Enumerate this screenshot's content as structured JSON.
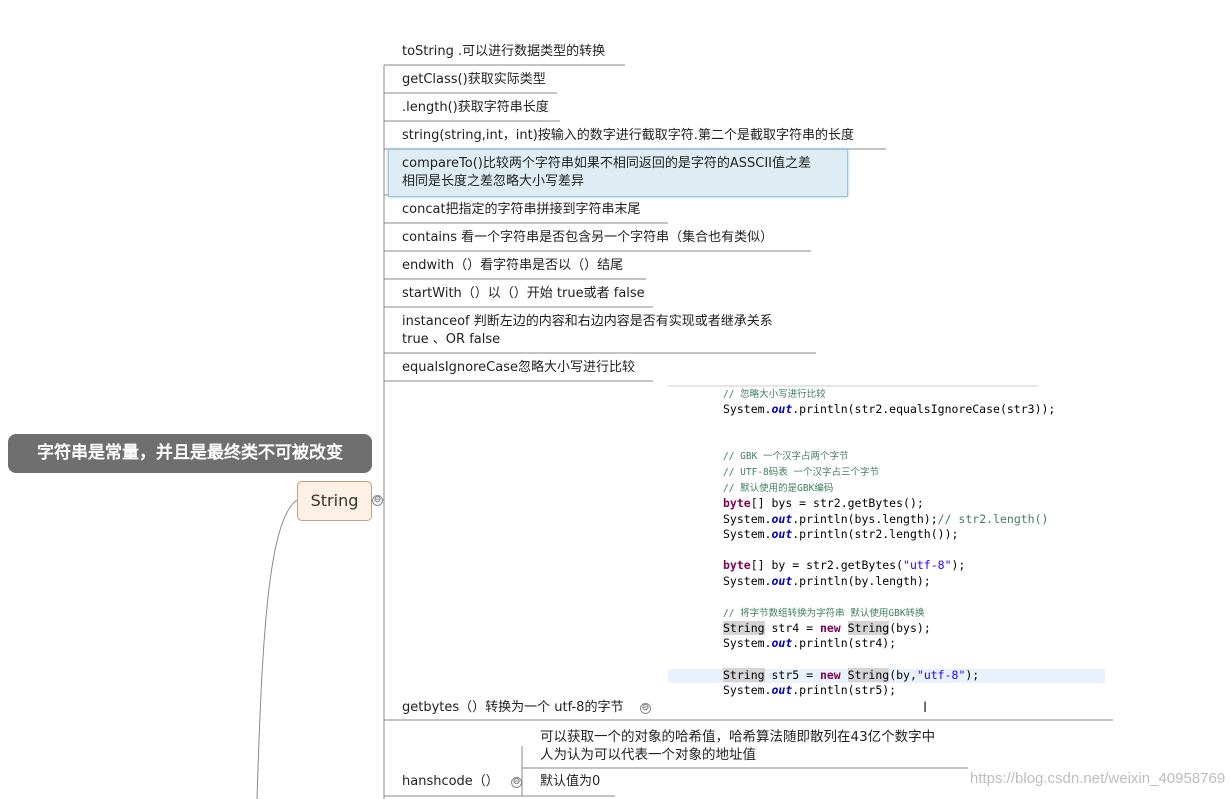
{
  "root": {
    "label": "字符串是常量，并且是最终类不可被改变"
  },
  "center": {
    "label": "String",
    "collapse_symbol": "⊖"
  },
  "topics": [
    {
      "id": "tostring",
      "lines": [
        "toString .可以进行数据类型的转换"
      ]
    },
    {
      "id": "getclass",
      "lines": [
        "getClass()获取实际类型"
      ]
    },
    {
      "id": "length",
      "lines": [
        ".length()获取字符串长度"
      ]
    },
    {
      "id": "substring",
      "lines": [
        "string(string,int，int)按输入的数字进行截取字符.第二个是截取字符串的长度"
      ]
    },
    {
      "id": "compareto",
      "lines": [
        "compareTo()比较两个字符串如果不相同返回的是字符的ASSCII值之差",
        "相同是长度之差忽略大小写差异"
      ]
    },
    {
      "id": "concat",
      "lines": [
        "concat把指定的字符串拼接到字符串末尾"
      ]
    },
    {
      "id": "contains",
      "lines": [
        "contains 看一个字符串是否包含另一个字符串（集合也有类似）"
      ]
    },
    {
      "id": "endwith",
      "lines": [
        "endwith（）看字符串是否以（）结尾"
      ]
    },
    {
      "id": "startwith",
      "lines": [
        "startWith（）以（）开始 true或者 false"
      ]
    },
    {
      "id": "instanceof",
      "lines": [
        "instanceof   判断左边的内容和右边内容是否有实现或者继承关系",
        "true       、OR   false"
      ]
    },
    {
      "id": "equalsignorecase",
      "lines": [
        "equalsIgnoreCase忽略大小写进行比较"
      ]
    },
    {
      "id": "getbytes",
      "lines": [
        "getbytes（）转换为一个 utf-8的字节"
      ]
    },
    {
      "id": "hashcode",
      "lines": [
        "hanshcode（）"
      ]
    }
  ],
  "hashcode_children": [
    {
      "id": "hash-desc",
      "lines": [
        "可以获取一个的对象的哈希值，哈希算法随即散列在43亿个数字中",
        "人为认为可以代表一个对象的地址值"
      ]
    },
    {
      "id": "hash-default",
      "lines": [
        "默认值为0"
      ]
    }
  ],
  "code_lines": [
    "// 忽略大小写进行比较",
    "System.out.println(str2.equalsIgnoreCase(str3));",
    "",
    "",
    "// GBK 一个汉字占两个字节",
    "// UTF-8码表 一个汉字占三个字节",
    "// 默认使用的是GBK编码",
    "byte[] bys = str2.getBytes();",
    "System.out.println(bys.length);// str2.length()",
    "System.out.println(str2.length());",
    "",
    "byte[] by = str2.getBytes(\"utf-8\");",
    "System.out.println(by.length);",
    "",
    "// 将字节数组转换为字符串 默认使用GBK转换",
    "String str4 = new String(bys);",
    "System.out.println(str4);",
    "",
    "String str5 = new String(by,\"utf-8\");",
    "System.out.println(str5);"
  ],
  "watermark": "https://blog.csdn.net/weixin_40958769",
  "colors": {
    "root_bg": "#6f6f6f",
    "center_bg": "#fdf1e6",
    "selected_bg": "#deedf3",
    "line": "#888888"
  }
}
